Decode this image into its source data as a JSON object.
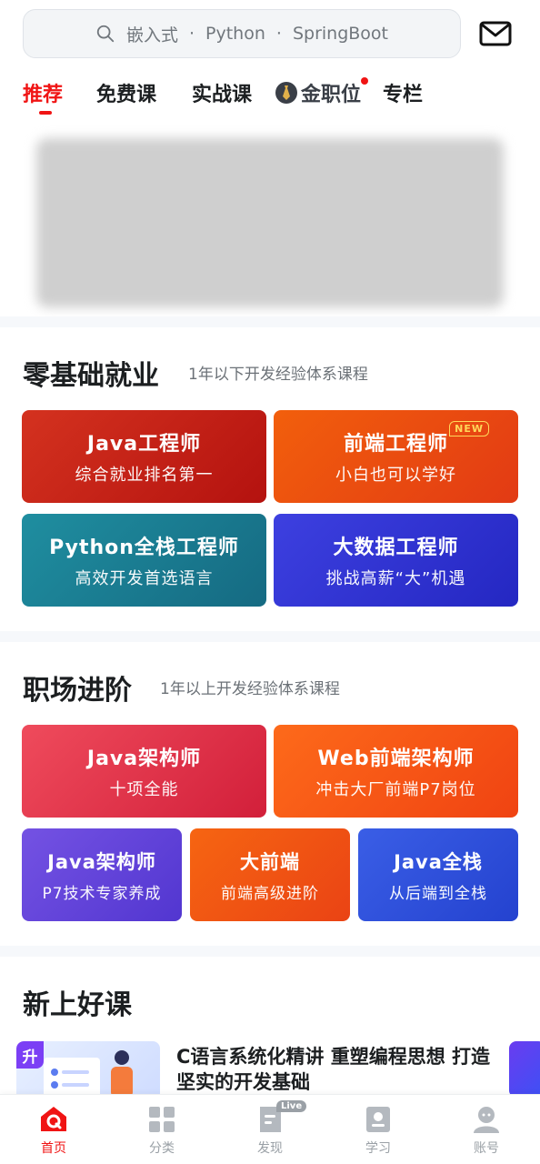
{
  "search": {
    "placeholder_parts": [
      "嵌入式",
      "·",
      "Python",
      "·",
      "SpringBoot"
    ]
  },
  "tabs": [
    {
      "label": "推荐",
      "active": true
    },
    {
      "label": "免费课",
      "active": false
    },
    {
      "label": "实战课",
      "active": false
    },
    {
      "label": "金职位",
      "active": false,
      "has_dot": true
    },
    {
      "label": "专栏",
      "active": false
    }
  ],
  "sections": {
    "zero": {
      "title": "零基础就业",
      "subtitle": "1年以下开发经验体系课程",
      "cards": [
        {
          "title": "Java工程师",
          "subtitle": "综合就业排名第一",
          "color": "#c8231e"
        },
        {
          "title": "前端工程师",
          "subtitle": "小白也可以学好",
          "badge": "NEW",
          "color": "#f2500f"
        },
        {
          "title": "Python全栈工程师",
          "subtitle": "高效开发首选语言",
          "color": "#197f95"
        },
        {
          "title": "大数据工程师",
          "subtitle": "挑战高薪“大”机遇",
          "color": "#3336d8"
        }
      ]
    },
    "career": {
      "title": "职场进阶",
      "subtitle": "1年以上开发经验体系课程",
      "cards": [
        {
          "title": "Java架构师",
          "subtitle": "十项全能",
          "color": "#e52f46"
        },
        {
          "title": "Web前端架构师",
          "subtitle": "冲击大厂前端P7岗位",
          "color": "#f75b16"
        },
        {
          "title": "Java架构师",
          "subtitle": "P7技术专家养成",
          "color": "#6644dc"
        },
        {
          "title": "大前端",
          "subtitle": "前端高级进阶",
          "color": "#f4560f"
        },
        {
          "title": "Java全栈",
          "subtitle": "从后端到全栈",
          "color": "#2f52dc"
        }
      ]
    },
    "new_courses": {
      "title": "新上好课",
      "course": {
        "badge": "升",
        "title": "C语言系统化精讲  重塑编程思想 打造坚实的开发基础"
      }
    }
  },
  "bottom_nav": [
    {
      "label": "首页",
      "active": true
    },
    {
      "label": "分类",
      "active": false
    },
    {
      "label": "发现",
      "active": false,
      "badge": "Live"
    },
    {
      "label": "学习",
      "active": false
    },
    {
      "label": "账号",
      "active": false
    }
  ],
  "colors": {
    "accent": "#f01414"
  }
}
